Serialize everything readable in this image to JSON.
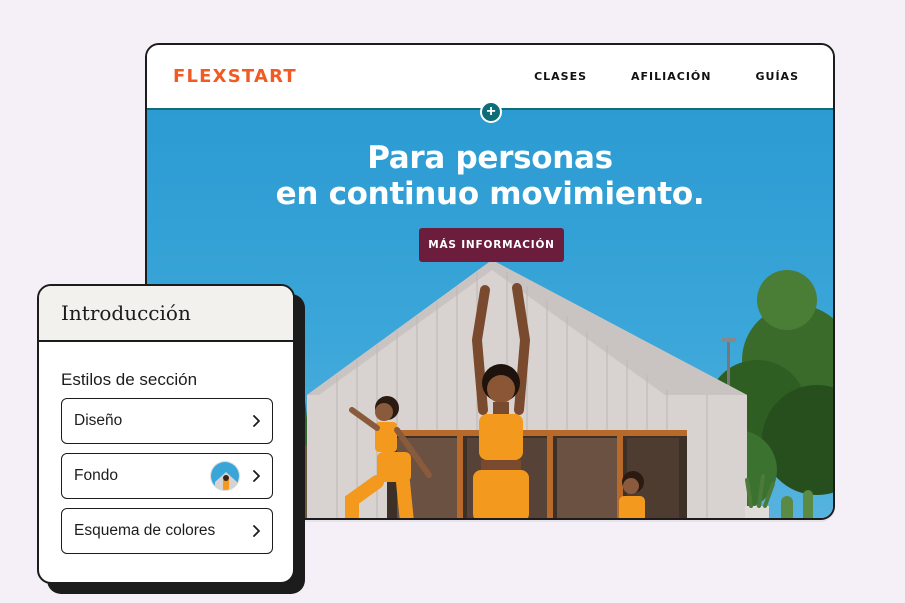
{
  "site": {
    "logo": "FLEXSTART",
    "nav": [
      "CLASES",
      "AFILIACIÓN",
      "GUÍAS"
    ],
    "add_section_symbol": "+"
  },
  "hero": {
    "title_line1": "Para personas",
    "title_line2": "en continuo movimiento.",
    "cta_label": "MÁS INFORMACIÓN"
  },
  "panel": {
    "title": "Introducción",
    "subtitle": "Estilos de sección",
    "options": [
      {
        "label": "Diseño"
      },
      {
        "label": "Fondo"
      },
      {
        "label": "Esquema de colores"
      }
    ]
  },
  "colors": {
    "brand_orange": "#f15a22",
    "teal": "#0f6d78",
    "cta_burgundy": "#6d1d3c",
    "sky_blue": "#2b9bd2",
    "background": "#f5f0f8"
  },
  "icons": {
    "add": "plus-icon",
    "chevron": "chevron-right-icon"
  }
}
